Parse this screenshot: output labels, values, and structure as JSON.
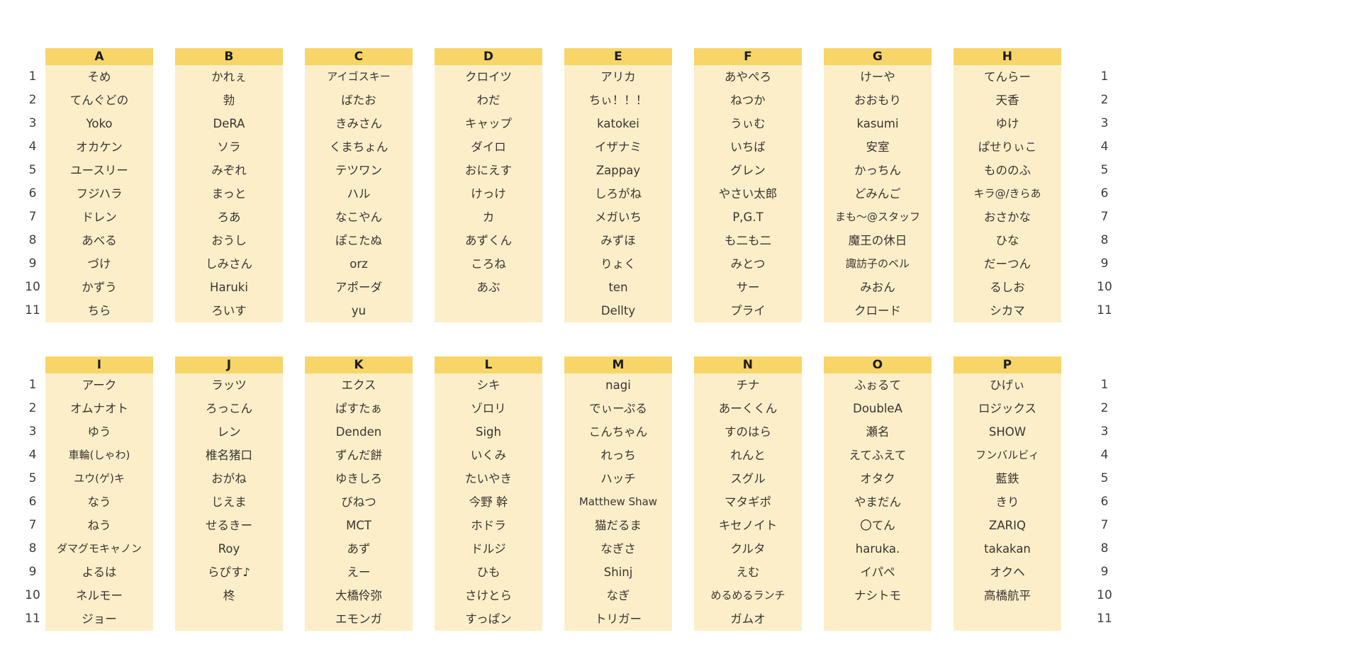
{
  "theme": {
    "header_bg": "#f8d568",
    "cell_bg": "#fceec9",
    "page_bg": "#ffffff",
    "text_color": "#3a3530",
    "header_text_color": "#1d1d1d"
  },
  "tables": [
    {
      "id": "table-top",
      "row_numbers": [
        "1",
        "2",
        "3",
        "4",
        "5",
        "6",
        "7",
        "8",
        "9",
        "10",
        "11"
      ],
      "columns": [
        {
          "header": "A",
          "cells": [
            "そめ",
            "てんぐどの",
            "Yoko",
            "オカケン",
            "ユースリー",
            "フジハラ",
            "ドレン",
            "あべる",
            "づけ",
            "かずう",
            "ちら"
          ]
        },
        {
          "header": "B",
          "cells": [
            "かれぇ",
            "勃",
            "DeRA",
            "ソラ",
            "みぞれ",
            "まっと",
            "ろあ",
            "おうし",
            "しみさん",
            "Haruki",
            "ろいす"
          ]
        },
        {
          "header": "C",
          "cells": [
            "アイゴスキー",
            "ばたお",
            "きみさん",
            "くまちょん",
            "テツワン",
            "ハル",
            "なこやん",
            "ぽこたぬ",
            "orz",
            "アポーダ",
            "yu"
          ]
        },
        {
          "header": "D",
          "cells": [
            "クロイツ",
            "わだ",
            "キャップ",
            "ダイロ",
            "おにえす",
            "けっけ",
            "カ",
            "あずくん",
            "ころね",
            "あぶ",
            ""
          ]
        },
        {
          "header": "E",
          "cells": [
            "アリカ",
            "ちぃ！！！",
            "katokei",
            "イザナミ",
            "Zappay",
            "しろがね",
            "メガいち",
            "みずほ",
            "りょく",
            "ten",
            "Dellty"
          ]
        },
        {
          "header": "F",
          "cells": [
            "あやぺろ",
            "ねつか",
            "うぃむ",
            "いちば",
            "グレン",
            "やさい太郎",
            "P,G.T",
            "も二も二",
            "みとつ",
            "サー",
            "プライ"
          ]
        },
        {
          "header": "G",
          "cells": [
            "けーや",
            "おおもり",
            "kasumi",
            "安室",
            "かっちん",
            "どみんご",
            "まも〜@スタッフ",
            "魔王の休日",
            "諏訪子のベル",
            "みおん",
            "クロード"
          ]
        },
        {
          "header": "H",
          "cells": [
            "てんらー",
            "天香",
            "ゆけ",
            "ぱせりぃこ",
            "もののふ",
            "キラ@/きらあ",
            "おさかな",
            "ひな",
            "だーつん",
            "るしお",
            "シカマ"
          ]
        }
      ]
    },
    {
      "id": "table-bottom",
      "row_numbers": [
        "1",
        "2",
        "3",
        "4",
        "5",
        "6",
        "7",
        "8",
        "9",
        "10",
        "11"
      ],
      "columns": [
        {
          "header": "I",
          "cells": [
            "アーク",
            "オムナオト",
            "ゆう",
            "車輪(しゃわ)",
            "ユウ(ゲ)キ",
            "なう",
            "ねう",
            "ダマグモキャノン",
            "よるは",
            "ネルモー",
            "ジョー"
          ]
        },
        {
          "header": "J",
          "cells": [
            "ラッツ",
            "ろっこん",
            "レン",
            "椎名猪口",
            "おがね",
            "じえま",
            "せるきー",
            "Roy",
            "らぴす♪",
            "柊",
            ""
          ]
        },
        {
          "header": "K",
          "cells": [
            "エクス",
            "ぱすたぁ",
            "Denden",
            "ずんだ餅",
            "ゆきしろ",
            "びねつ",
            "MCT",
            "あず",
            "えー",
            "大橋伶弥",
            "エモンガ"
          ]
        },
        {
          "header": "L",
          "cells": [
            "シキ",
            "ゾロリ",
            "Sigh",
            "いくみ",
            "たいやき",
            "今野 幹",
            "ホドラ",
            "ドルジ",
            "ひも",
            "さけとら",
            "すっぱン"
          ]
        },
        {
          "header": "M",
          "cells": [
            "nagi",
            "でぃーぷる",
            "こんちゃん",
            "れっち",
            "ハッチ",
            "Matthew Shaw",
            "猫だるま",
            "なぎさ",
            "Shinj",
            "なぎ",
            "トリガー"
          ]
        },
        {
          "header": "N",
          "cells": [
            "チナ",
            "あーくくん",
            "すのはら",
            "れんと",
            "スグル",
            "マタギポ",
            "キセノイト",
            "クルタ",
            "えむ",
            "めるめるランチ",
            "ガムオ"
          ]
        },
        {
          "header": "O",
          "cells": [
            "ふぉるて",
            "DoubleA",
            "瀬名",
            "えてふえて",
            "オタク",
            "やまだん",
            "〇てん",
            "haruka.",
            "イパペ",
            "ナシトモ",
            ""
          ]
        },
        {
          "header": "P",
          "cells": [
            "ひげぃ",
            "ロジックス",
            "SHOW",
            "フンバルビィ",
            "藍鉄",
            "きり",
            "ZARIQ",
            "takakan",
            "オクヘ",
            "高橋航平",
            ""
          ]
        }
      ]
    }
  ]
}
